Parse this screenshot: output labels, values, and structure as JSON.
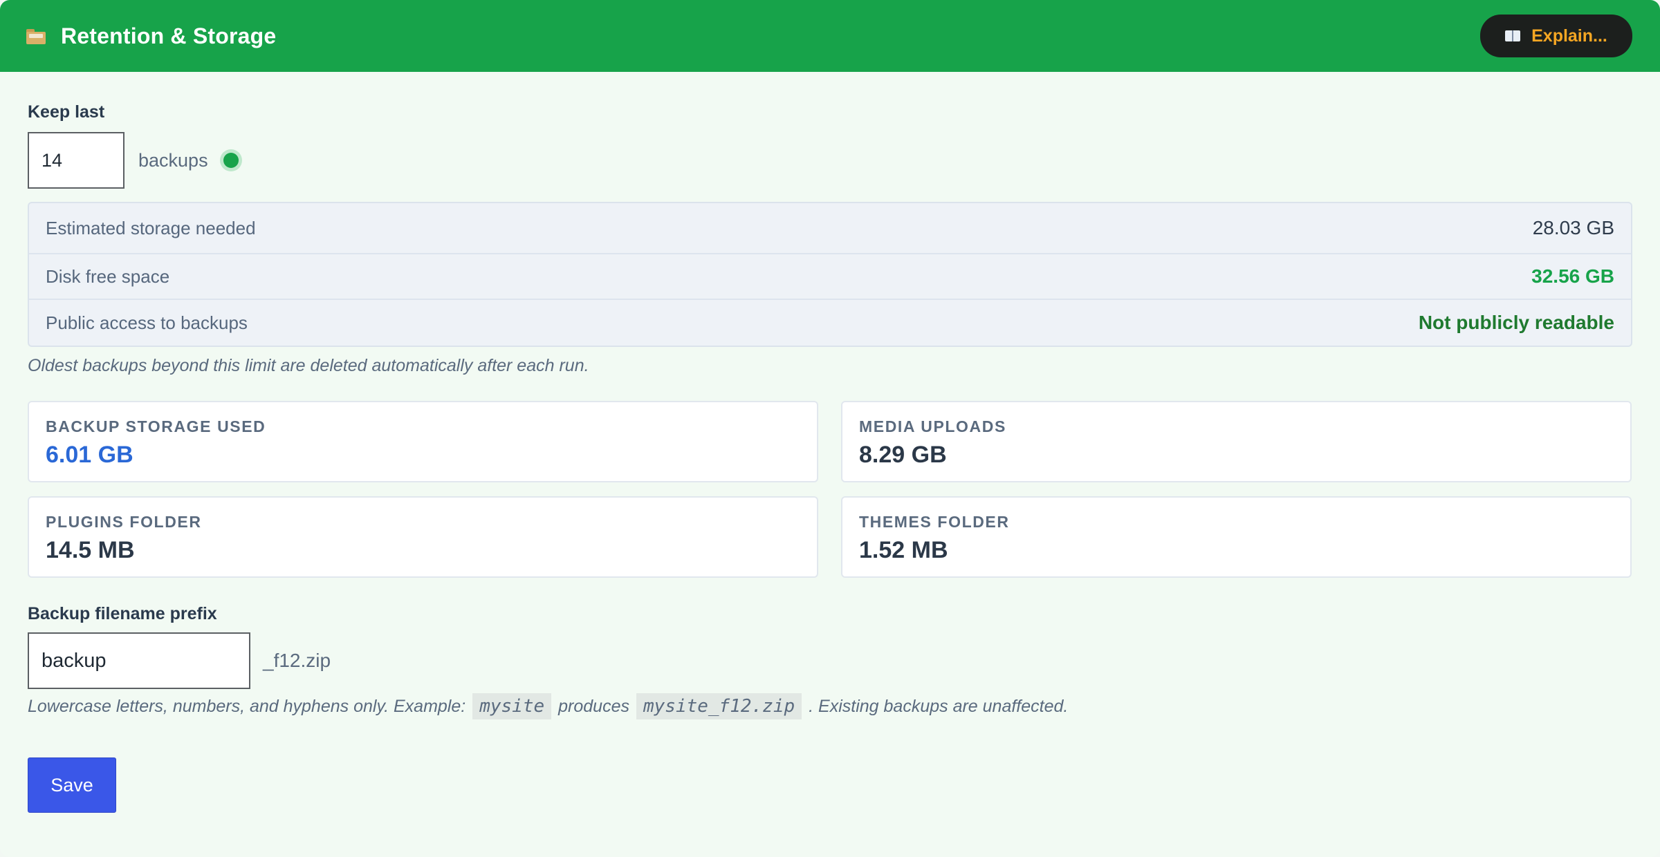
{
  "header": {
    "title": "Retention & Storage",
    "title_icon": "folder-icon",
    "explain_label": "Explain...",
    "explain_icon": "book-icon"
  },
  "retention": {
    "keep_label": "Keep last",
    "keep_value": "14",
    "unit_label": "backups",
    "status": "ok"
  },
  "info_rows": [
    {
      "label": "Estimated storage needed",
      "value": "28.03 GB"
    },
    {
      "label": "Disk free space",
      "value": "32.56 GB"
    },
    {
      "label": "Public access to backups",
      "value": "Not publicly readable"
    }
  ],
  "retention_hint": "Oldest backups beyond this limit are deleted automatically after each run.",
  "stats": [
    {
      "label": "BACKUP STORAGE USED",
      "value": "6.01 GB"
    },
    {
      "label": "MEDIA UPLOADS",
      "value": "8.29 GB"
    },
    {
      "label": "PLUGINS FOLDER",
      "value": "14.5 MB"
    },
    {
      "label": "THEMES FOLDER",
      "value": "1.52 MB"
    }
  ],
  "prefix": {
    "label": "Backup filename prefix",
    "value": "backup",
    "suffix": "_f12.zip",
    "hint_part1": "Lowercase letters, numbers, and hyphens only. Example:",
    "example_input": "mysite",
    "hint_part2": "produces",
    "example_output": "mysite_f12.zip",
    "hint_part3": ". Existing backups are unaffected."
  },
  "actions": {
    "save_label": "Save"
  },
  "colors": {
    "header_bg": "#17a34a",
    "accent_blue": "#2a68d6",
    "ok_green": "#17a34a",
    "save_bg": "#3a57e8"
  }
}
